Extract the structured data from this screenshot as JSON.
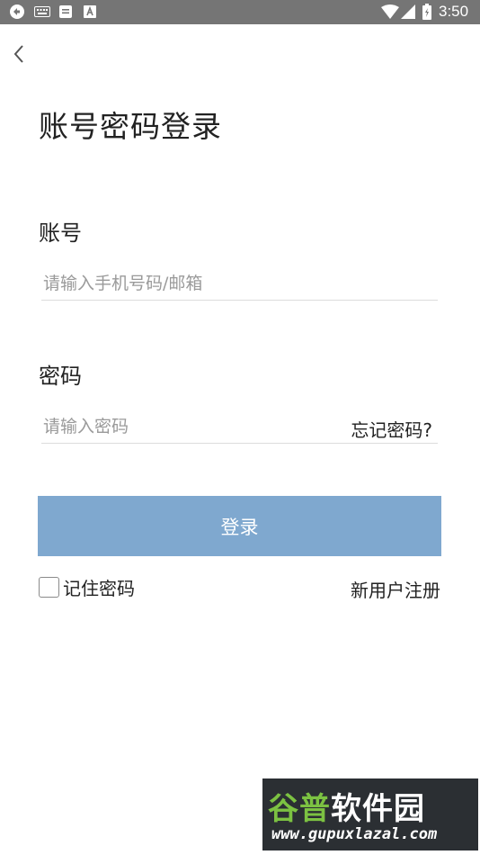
{
  "status_bar": {
    "time": "3:50",
    "left_icons": [
      "sync-icon",
      "keyboard-icon",
      "message-icon",
      "font-icon"
    ],
    "right_icons": [
      "wifi-icon",
      "signal-icon",
      "battery-icon"
    ]
  },
  "header": {
    "back_icon": "chevron-left-icon"
  },
  "title": "账号密码登录",
  "account": {
    "label": "账号",
    "placeholder": "请输入手机号码/邮箱",
    "value": ""
  },
  "password": {
    "label": "密码",
    "placeholder": "请输入密码",
    "value": "",
    "forgot_label": "忘记密码?"
  },
  "login_button": "登录",
  "remember": {
    "label": "记住密码",
    "checked": false
  },
  "register_label": "新用户注册",
  "watermark": {
    "title_part1": "谷普",
    "title_part2": "软件园",
    "url": "www.gupuxlazal.com"
  },
  "colors": {
    "status_bar": "#757575",
    "login_button": "#7fa8cf",
    "watermark_bg": "#2b2f33",
    "watermark_accent": "#7cc242"
  }
}
